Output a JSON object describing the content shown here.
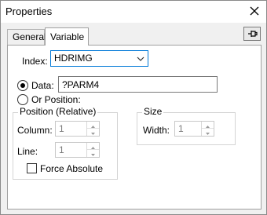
{
  "window": {
    "title": "Properties"
  },
  "tabs": [
    {
      "label": "General",
      "selected": false
    },
    {
      "label": "Variable",
      "selected": true
    }
  ],
  "variable": {
    "index_label": "Index:",
    "index_value": "HDRIMG",
    "data_label": "Data:",
    "data_value": "?PARM4",
    "data_selected": true,
    "or_position_label": "Or Position:",
    "or_position_selected": false,
    "position_group": {
      "title": "Position (Relative)",
      "column_label": "Column:",
      "column_value": "1",
      "line_label": "Line:",
      "line_value": "1",
      "force_absolute_label": "Force Absolute",
      "force_absolute_checked": false
    },
    "size_group": {
      "title": "Size",
      "width_label": "Width:",
      "width_value": "1"
    }
  },
  "colors": {
    "focus_border": "#0078d7",
    "panel_bg": "#ffffff",
    "window_bg": "#f0f0f0"
  },
  "icons": {
    "close": "close-icon",
    "pin": "pin-icon",
    "dropdown": "chevron-down-icon"
  }
}
